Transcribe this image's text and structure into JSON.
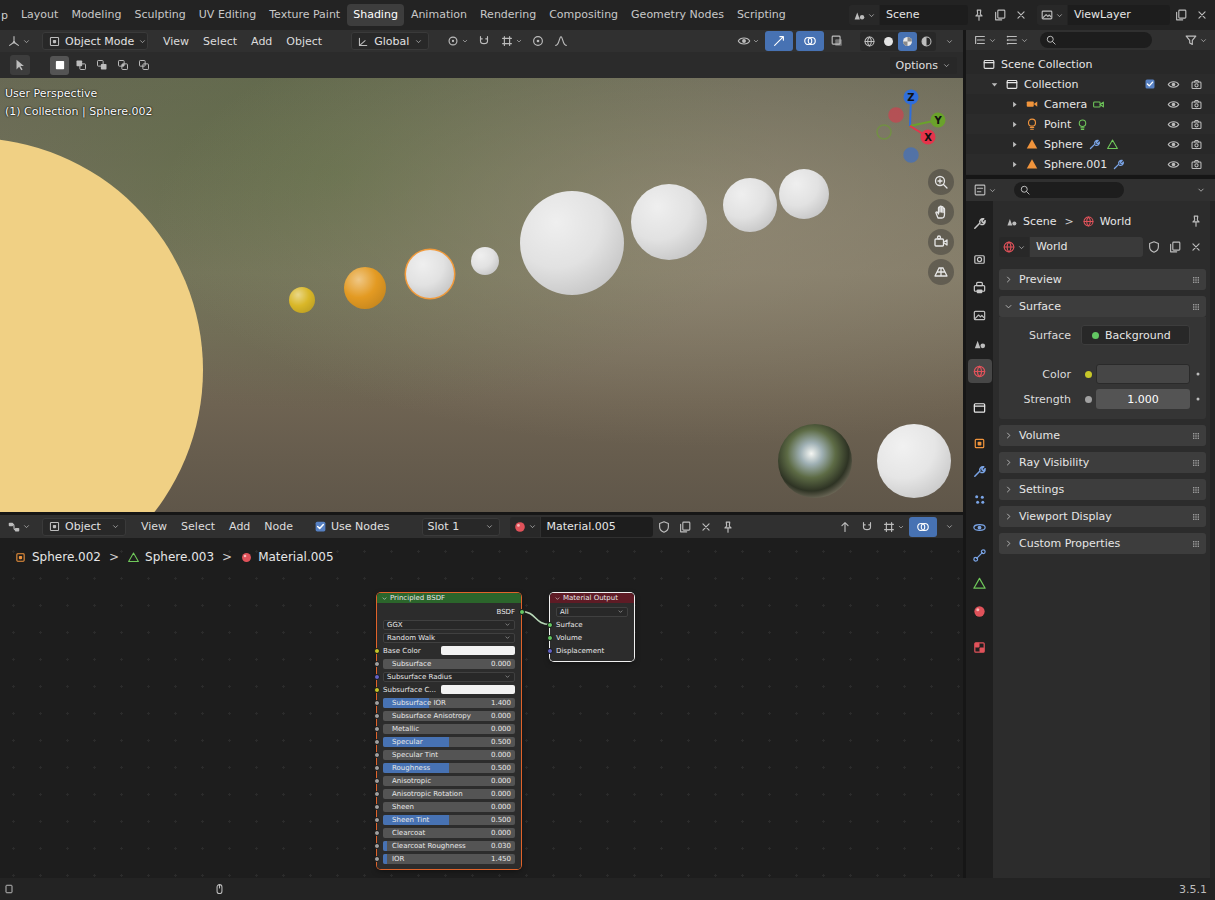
{
  "topbar": {
    "menu_cut": "p",
    "workspaces": [
      {
        "label": "Layout",
        "selected": false
      },
      {
        "label": "Modeling",
        "selected": false
      },
      {
        "label": "Sculpting",
        "selected": false
      },
      {
        "label": "UV Editing",
        "selected": false
      },
      {
        "label": "Texture Paint",
        "selected": false
      },
      {
        "label": "Shading",
        "selected": true
      },
      {
        "label": "Animation",
        "selected": false
      },
      {
        "label": "Rendering",
        "selected": false
      },
      {
        "label": "Compositing",
        "selected": false
      },
      {
        "label": "Geometry Nodes",
        "selected": false
      },
      {
        "label": "Scripting",
        "selected": false
      }
    ],
    "scene": "Scene",
    "view_layer": "ViewLayer"
  },
  "viewport": {
    "mode": "Object Mode",
    "menus": [
      "View",
      "Select",
      "Add",
      "Object"
    ],
    "orientation": "Global",
    "options": "Options",
    "perspective": "User Perspective",
    "context": "(1) Collection | Sphere.002",
    "axes": [
      {
        "label": "Z",
        "color": "#2f6edb"
      },
      {
        "label": "Y",
        "color": "#6aa22b"
      },
      {
        "label": "X",
        "color": "#e5344b"
      }
    ],
    "shading": [
      {
        "kind": "shade-wire",
        "selected": false
      },
      {
        "kind": "shade-solid",
        "selected": false
      },
      {
        "kind": "shade-material",
        "selected": true
      },
      {
        "kind": "shade-rendered",
        "selected": false
      }
    ],
    "select_modes": [
      {
        "kind": "sel-new",
        "selected": true
      },
      {
        "kind": "sel-extend",
        "selected": false
      },
      {
        "kind": "sel-subtract",
        "selected": false
      },
      {
        "kind": "sel-invert",
        "selected": false
      },
      {
        "kind": "sel-intersect",
        "selected": false
      }
    ],
    "objects": [
      {
        "kind": "sun",
        "color": "#f0d084",
        "selected": false
      },
      {
        "kind": "sphere",
        "color": "#d9b728",
        "selected": false
      },
      {
        "kind": "sphere",
        "color": "#e39a22",
        "selected": false
      },
      {
        "kind": "sphere",
        "color": "#e2e2e2",
        "selected": true
      },
      {
        "kind": "sphere",
        "color": "#e2e2e2",
        "selected": false
      },
      {
        "kind": "sphere",
        "color": "#e2e2e2",
        "selected": false
      },
      {
        "kind": "sphere",
        "color": "#e2e2e2",
        "selected": false
      },
      {
        "kind": "sphere",
        "color": "#e2e2e2",
        "selected": false
      },
      {
        "kind": "sphere",
        "color": "#e2e2e2",
        "selected": false
      },
      {
        "kind": "chrome",
        "color": "#5d6b45",
        "selected": false
      },
      {
        "kind": "sphere",
        "color": "#e6e6e6",
        "selected": false
      }
    ]
  },
  "node_editor": {
    "mode": "Object",
    "menus": [
      "View",
      "Select",
      "Add",
      "Node"
    ],
    "use_nodes": {
      "label": "Use Nodes",
      "checked": true
    },
    "slot": "Slot 1",
    "material": "Material.005",
    "breadcrumb": [
      {
        "label": "Sphere.002",
        "kind": "object"
      },
      {
        "label": "Sphere.003",
        "kind": "mesh-data"
      },
      {
        "label": "Material.005",
        "kind": "material"
      }
    ],
    "separator": ">",
    "bsdf": {
      "title": "Principled BSDF",
      "output": "BSDF",
      "output_color": "#63c763",
      "selected": true,
      "rows": [
        {
          "kind": "select",
          "label": "GGX"
        },
        {
          "kind": "select",
          "label": "Random Walk"
        },
        {
          "kind": "color",
          "label": "Base Color",
          "color": "#c7c729",
          "swatch": "#f2f2f2"
        },
        {
          "kind": "slider",
          "label": "Subsurface",
          "value": "0.000",
          "level": 0,
          "color": "#a1a1a1"
        },
        {
          "kind": "vector",
          "label": "Subsurface Radius",
          "color": "#6363c7"
        },
        {
          "kind": "color",
          "label": "Subsurface C...",
          "color": "#c7c729",
          "swatch": "#f2f2f2"
        },
        {
          "kind": "slider",
          "label": "Subsurface IOR",
          "value": "1.400",
          "level": 0.35,
          "color": "#a1a1a1"
        },
        {
          "kind": "slider",
          "label": "Subsurface Anisotropy",
          "value": "0.000",
          "level": 0,
          "color": "#a1a1a1"
        },
        {
          "kind": "slider",
          "label": "Metallic",
          "value": "0.000",
          "level": 0,
          "color": "#a1a1a1"
        },
        {
          "kind": "slider",
          "label": "Specular",
          "value": "0.500",
          "level": 0.5,
          "color": "#a1a1a1"
        },
        {
          "kind": "slider",
          "label": "Specular Tint",
          "value": "0.000",
          "level": 0,
          "color": "#a1a1a1"
        },
        {
          "kind": "slider",
          "label": "Roughness",
          "value": "0.500",
          "level": 0.5,
          "color": "#a1a1a1"
        },
        {
          "kind": "slider",
          "label": "Anisotropic",
          "value": "0.000",
          "level": 0,
          "color": "#a1a1a1"
        },
        {
          "kind": "slider",
          "label": "Anisotropic Rotation",
          "value": "0.000",
          "level": 0,
          "color": "#a1a1a1"
        },
        {
          "kind": "slider",
          "label": "Sheen",
          "value": "0.000",
          "level": 0,
          "color": "#a1a1a1"
        },
        {
          "kind": "slider",
          "label": "Sheen Tint",
          "value": "0.500",
          "level": 0.5,
          "color": "#a1a1a1"
        },
        {
          "kind": "slider",
          "label": "Clearcoat",
          "value": "0.000",
          "level": 0,
          "color": "#a1a1a1"
        },
        {
          "kind": "slider",
          "label": "Clearcoat Roughness",
          "value": "0.030",
          "level": 0.03,
          "color": "#a1a1a1"
        },
        {
          "kind": "slider",
          "label": "IOR",
          "value": "1.450",
          "level": 0.03,
          "color": "#a1a1a1"
        }
      ]
    },
    "output": {
      "title": "Material Output",
      "target": "All",
      "active": true,
      "inputs": [
        {
          "label": "Surface",
          "color": "#63c763"
        },
        {
          "label": "Volume",
          "color": "#63c763"
        },
        {
          "label": "Displacement",
          "color": "#6363c7"
        }
      ]
    }
  },
  "outliner": {
    "root": "Scene Collection",
    "items": [
      {
        "label": "Collection",
        "kind": "collection",
        "depth": 1,
        "expanded": true,
        "checked": true,
        "visible": true,
        "renderable": true,
        "extras": []
      },
      {
        "label": "Camera",
        "kind": "obj-camera",
        "depth": 2,
        "expanded": false,
        "visible": true,
        "renderable": true,
        "extras": [
          "camera-data"
        ]
      },
      {
        "label": "Point",
        "kind": "obj-light",
        "depth": 2,
        "expanded": false,
        "visible": true,
        "renderable": true,
        "extras": [
          "light-data"
        ]
      },
      {
        "label": "Sphere",
        "kind": "obj-mesh",
        "depth": 2,
        "expanded": false,
        "visible": true,
        "renderable": true,
        "extras": [
          "modifiers",
          "mesh-data"
        ]
      },
      {
        "label": "Sphere.001",
        "kind": "obj-mesh",
        "depth": 2,
        "expanded": false,
        "visible": true,
        "renderable": true,
        "extras": [
          "modifiers"
        ]
      }
    ]
  },
  "properties": {
    "tabs": [
      {
        "kind": "tool",
        "selected": false
      },
      {
        "kind": "render",
        "selected": false
      },
      {
        "kind": "output",
        "selected": false
      },
      {
        "kind": "view-layer",
        "selected": false
      },
      {
        "kind": "scene",
        "selected": false
      },
      {
        "kind": "world",
        "selected": true
      },
      {
        "kind": "collection",
        "selected": false
      },
      {
        "kind": "object",
        "selected": false
      },
      {
        "kind": "modifiers",
        "selected": false
      },
      {
        "kind": "particles",
        "selected": false
      },
      {
        "kind": "physics",
        "selected": false
      },
      {
        "kind": "constraints",
        "selected": false
      },
      {
        "kind": "data",
        "selected": false
      },
      {
        "kind": "material",
        "selected": false
      },
      {
        "kind": "texture",
        "selected": false
      }
    ],
    "path": [
      {
        "label": "Scene",
        "kind": "scene"
      },
      {
        "label": "World",
        "kind": "world"
      }
    ],
    "separator": ">",
    "datablock": "World",
    "panels": [
      {
        "label": "Preview",
        "expanded": false
      },
      {
        "label": "Surface",
        "expanded": true
      },
      {
        "label": "Volume",
        "expanded": false
      },
      {
        "label": "Ray Visibility",
        "expanded": false
      },
      {
        "label": "Settings",
        "expanded": false
      },
      {
        "label": "Viewport Display",
        "expanded": false
      },
      {
        "label": "Custom Properties",
        "expanded": false
      }
    ],
    "surface_fields": [
      {
        "label": "Surface",
        "kind": "shader",
        "value": "Background",
        "color": "#63c763"
      },
      {
        "label": "Color",
        "kind": "color",
        "color": "#c7c729",
        "swatch": "#464646"
      },
      {
        "label": "Strength",
        "kind": "number",
        "value": "1.000",
        "color": "#a1a1a1"
      }
    ]
  },
  "status_bar": {
    "version": "3.5.1"
  }
}
